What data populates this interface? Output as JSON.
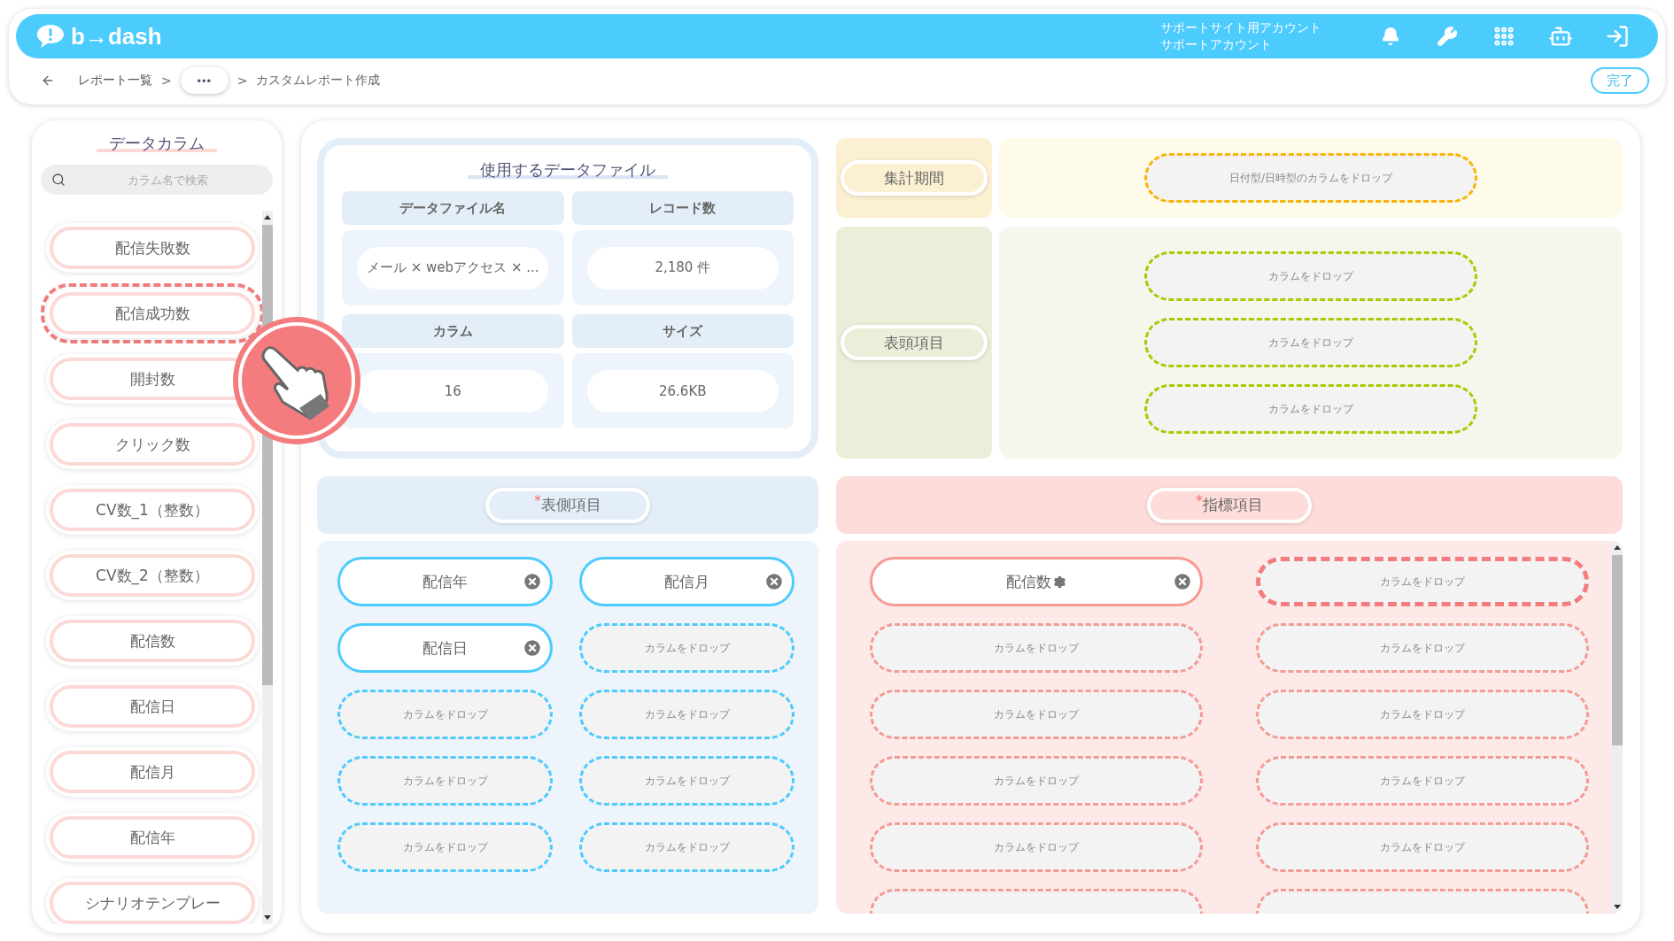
{
  "header": {
    "logo": "b→dash",
    "account_lines": [
      "サポートサイト用アカウント",
      "サポートアカウント"
    ]
  },
  "breadcrumb": {
    "items": [
      {
        "kind": "link",
        "label": "レポート一覧"
      },
      {
        "kind": "more",
        "label": "•••"
      },
      {
        "kind": "current",
        "label": "カスタムレポート作成"
      }
    ],
    "separator": ">"
  },
  "done_button": "完了",
  "sidebar": {
    "title": "データカラム",
    "search": {
      "placeholder": "カラム名で検索"
    },
    "items": [
      {
        "label": "配信失敗数",
        "dragging": false
      },
      {
        "label": "配信成功数",
        "dragging": true
      },
      {
        "label": "開封数",
        "dragging": false
      },
      {
        "label": "クリック数",
        "dragging": false
      },
      {
        "label": "CV数_1（整数）",
        "dragging": false
      },
      {
        "label": "CV数_2（整数）",
        "dragging": false
      },
      {
        "label": "配信数",
        "dragging": false
      },
      {
        "label": "配信日",
        "dragging": false
      },
      {
        "label": "配信月",
        "dragging": false
      },
      {
        "label": "配信年",
        "dragging": false
      },
      {
        "label": "シナリオテンプレー",
        "dragging": false
      }
    ]
  },
  "data_file": {
    "title": "使用するデータファイル",
    "fields": [
      {
        "label": "データファイル名",
        "value": "メール × webアクセス × ..."
      },
      {
        "label": "レコード数",
        "value": "2,180 件"
      },
      {
        "label": "カラム",
        "value": "16"
      },
      {
        "label": "サイズ",
        "value": "26.6KB"
      }
    ]
  },
  "period": {
    "label": "集計期間",
    "slots": [
      {
        "kind": "empty",
        "placeholder": "日付型/日時型のカラムをドロップ",
        "drop_target": false
      }
    ]
  },
  "column_headers": {
    "label": "表頭項目",
    "slots": [
      {
        "kind": "empty",
        "placeholder": "カラムをドロップ",
        "drop_target": false
      },
      {
        "kind": "empty",
        "placeholder": "カラムをドロップ",
        "drop_target": false
      },
      {
        "kind": "empty",
        "placeholder": "カラムをドロップ",
        "drop_target": false
      }
    ]
  },
  "row_headers": {
    "label": "表側項目",
    "required_mark": "*",
    "slots": [
      {
        "kind": "filled",
        "label": "配信年",
        "settings": false
      },
      {
        "kind": "filled",
        "label": "配信月",
        "settings": false
      },
      {
        "kind": "filled",
        "label": "配信日",
        "settings": false
      },
      {
        "kind": "empty",
        "placeholder": "カラムをドロップ",
        "drop_target": false
      },
      {
        "kind": "empty",
        "placeholder": "カラムをドロップ",
        "drop_target": false
      },
      {
        "kind": "empty",
        "placeholder": "カラムをドロップ",
        "drop_target": false
      },
      {
        "kind": "empty",
        "placeholder": "カラムをドロップ",
        "drop_target": false
      },
      {
        "kind": "empty",
        "placeholder": "カラムをドロップ",
        "drop_target": false
      },
      {
        "kind": "empty",
        "placeholder": "カラムをドロップ",
        "drop_target": false
      },
      {
        "kind": "empty",
        "placeholder": "カラムをドロップ",
        "drop_target": false
      }
    ]
  },
  "metrics": {
    "label": "指標項目",
    "required_mark": "*",
    "slots": [
      {
        "kind": "filled",
        "label": "配信数",
        "settings": true
      },
      {
        "kind": "empty",
        "placeholder": "カラムをドロップ",
        "drop_target": true
      },
      {
        "kind": "empty",
        "placeholder": "カラムをドロップ",
        "drop_target": false
      },
      {
        "kind": "empty",
        "placeholder": "カラムをドロップ",
        "drop_target": false
      },
      {
        "kind": "empty",
        "placeholder": "カラムをドロップ",
        "drop_target": false
      },
      {
        "kind": "empty",
        "placeholder": "カラムをドロップ",
        "drop_target": false
      },
      {
        "kind": "empty",
        "placeholder": "カラムをドロップ",
        "drop_target": false
      },
      {
        "kind": "empty",
        "placeholder": "カラムをドロップ",
        "drop_target": false
      },
      {
        "kind": "empty",
        "placeholder": "カラムをドロップ",
        "drop_target": false
      },
      {
        "kind": "empty",
        "placeholder": "カラムをドロップ",
        "drop_target": false
      },
      {
        "kind": "partial",
        "drop_target": false
      },
      {
        "kind": "partial",
        "drop_target": false
      }
    ]
  }
}
